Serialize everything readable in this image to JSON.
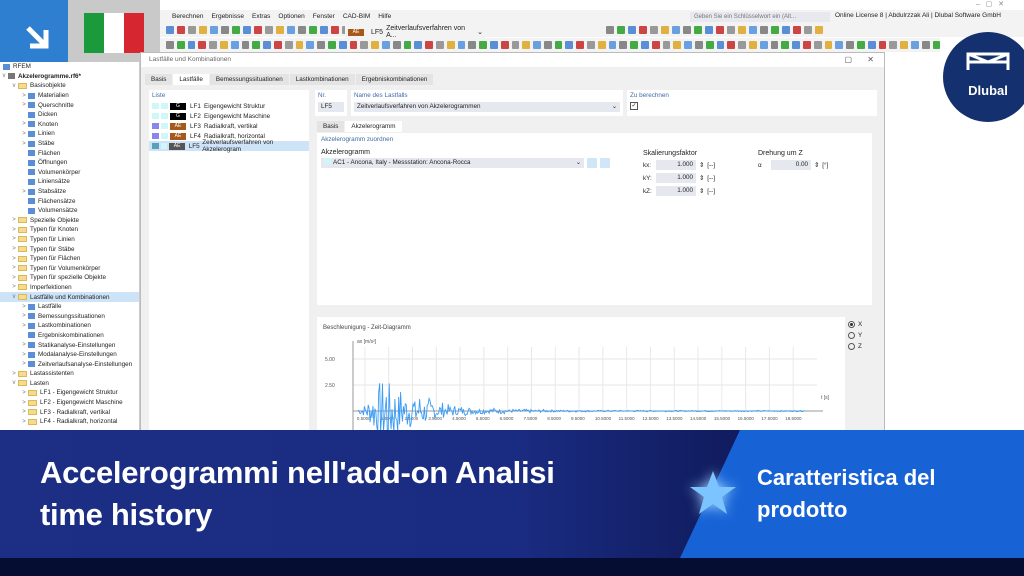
{
  "menu": [
    "Berechnen",
    "Ergebnisse",
    "Extras",
    "Optionen",
    "Fenster",
    "CAD-BIM",
    "Hilfe"
  ],
  "search_placeholder": "Geben Sie ein Schlüsselwort ein (Alt...",
  "license": "Online License 8 | Abdulrzzak Ali | Dlubal Software GmbH",
  "toolbar": {
    "lc_badge": "AE",
    "lc_id": "LF5",
    "lc_name": "Zeitverlaufsverfahren von A..."
  },
  "tree": {
    "root": "RFEM",
    "file": "Akzelerogramme.rf6*",
    "items": [
      {
        "label": "Basisobjekte",
        "lvl": 1,
        "type": "folder",
        "exp": "v"
      },
      {
        "label": "Materialien",
        "lvl": 2,
        "type": "obj",
        "exp": ">"
      },
      {
        "label": "Querschnitte",
        "lvl": 2,
        "type": "obj",
        "exp": ">"
      },
      {
        "label": "Dicken",
        "lvl": 2,
        "type": "obj",
        "exp": ""
      },
      {
        "label": "Knoten",
        "lvl": 2,
        "type": "obj",
        "exp": ">"
      },
      {
        "label": "Linien",
        "lvl": 2,
        "type": "obj",
        "exp": ">"
      },
      {
        "label": "Stäbe",
        "lvl": 2,
        "type": "obj",
        "exp": ">"
      },
      {
        "label": "Flächen",
        "lvl": 2,
        "type": "obj",
        "exp": ""
      },
      {
        "label": "Öffnungen",
        "lvl": 2,
        "type": "obj",
        "exp": ""
      },
      {
        "label": "Volumenkörper",
        "lvl": 2,
        "type": "obj",
        "exp": ""
      },
      {
        "label": "Liniensätze",
        "lvl": 2,
        "type": "obj",
        "exp": ""
      },
      {
        "label": "Stabsätze",
        "lvl": 2,
        "type": "obj",
        "exp": ">"
      },
      {
        "label": "Flächensätze",
        "lvl": 2,
        "type": "obj",
        "exp": ""
      },
      {
        "label": "Volumensätze",
        "lvl": 2,
        "type": "obj",
        "exp": ""
      },
      {
        "label": "Spezielle Objekte",
        "lvl": 1,
        "type": "folder",
        "exp": ">"
      },
      {
        "label": "Typen für Knoten",
        "lvl": 1,
        "type": "folder",
        "exp": ">"
      },
      {
        "label": "Typen für Linien",
        "lvl": 1,
        "type": "folder",
        "exp": ">"
      },
      {
        "label": "Typen für Stäbe",
        "lvl": 1,
        "type": "folder",
        "exp": ">"
      },
      {
        "label": "Typen für Flächen",
        "lvl": 1,
        "type": "folder",
        "exp": ">"
      },
      {
        "label": "Typen für Volumenkörper",
        "lvl": 1,
        "type": "folder",
        "exp": ">"
      },
      {
        "label": "Typen für spezielle Objekte",
        "lvl": 1,
        "type": "folder",
        "exp": ">"
      },
      {
        "label": "Imperfektionen",
        "lvl": 1,
        "type": "folder",
        "exp": ">"
      },
      {
        "label": "Lastfälle und Kombinationen",
        "lvl": 1,
        "type": "folder",
        "exp": "v",
        "sel": true
      },
      {
        "label": "Lastfälle",
        "lvl": 2,
        "type": "obj",
        "exp": ">"
      },
      {
        "label": "Bemessungssituationen",
        "lvl": 2,
        "type": "obj",
        "exp": ">"
      },
      {
        "label": "Lastkombinationen",
        "lvl": 2,
        "type": "obj",
        "exp": ">"
      },
      {
        "label": "Ergebniskombinationen",
        "lvl": 2,
        "type": "obj",
        "exp": ""
      },
      {
        "label": "Statikanalyse-Einstellungen",
        "lvl": 2,
        "type": "obj",
        "exp": ">"
      },
      {
        "label": "Modalanalyse-Einstellungen",
        "lvl": 2,
        "type": "obj",
        "exp": ">"
      },
      {
        "label": "Zeitverlaufsanalyse-Einstellungen",
        "lvl": 2,
        "type": "obj",
        "exp": ">"
      },
      {
        "label": "Lastassistenten",
        "lvl": 1,
        "type": "folder",
        "exp": ">"
      },
      {
        "label": "Lasten",
        "lvl": 1,
        "type": "folder",
        "exp": "v"
      },
      {
        "label": "LF1 - Eigengewicht Struktur",
        "lvl": 2,
        "type": "folder",
        "exp": ">"
      },
      {
        "label": "LF2 - Eigengewicht Maschine",
        "lvl": 2,
        "type": "folder",
        "exp": ">"
      },
      {
        "label": "LF3 - Radialkraft, vertikal",
        "lvl": 2,
        "type": "folder",
        "exp": ">"
      },
      {
        "label": "LF4 - Radialkraft, horizontal",
        "lvl": 2,
        "type": "folder",
        "exp": ">"
      }
    ]
  },
  "dialog": {
    "title": "Lastfälle und Kombinationen",
    "tabs": [
      "Basis",
      "Lastfälle",
      "Bemessungssituationen",
      "Lastkombinationen",
      "Ergebniskombinationen"
    ],
    "list_label": "Liste",
    "list": [
      {
        "id": "LF1",
        "name": "Eigengewicht Struktur",
        "badge": "G",
        "badge_color": "#000000",
        "c1": "#cff7fa"
      },
      {
        "id": "LF2",
        "name": "Eigengewicht Maschine",
        "badge": "G",
        "badge_color": "#000000",
        "c1": "#cff7fa"
      },
      {
        "id": "LF3",
        "name": "Radialkraft, vertikal",
        "badge": "AE",
        "badge_color": "#a55a1c",
        "c1": "#8a86f0"
      },
      {
        "id": "LF4",
        "name": "Radialkraft, horizontal",
        "badge": "AE",
        "badge_color": "#a55a1c",
        "c1": "#8a86f0"
      },
      {
        "id": "LF5",
        "name": "Zeitverlaufsverfahren von Akzelerogram",
        "badge": "AE",
        "badge_color": "#555555",
        "c1": "#5aa0b8"
      }
    ],
    "nr_label": "Nr.",
    "nr_value": "LF5",
    "name_label": "Name des Lastfalls",
    "name_value": "Zeitverlaufsverfahren von Akzelerogrammen",
    "calc_label": "Zu berechnen",
    "subtabs": [
      "Basis",
      "Akzelerogramm"
    ],
    "assign_label": "Akzelerogramm zuordnen",
    "accel_label": "Akzelerogramm",
    "accel_value": "AC1 - Ancona, Italy - Messstation: Ancona-Rocca",
    "scale_label": "Skalierungsfaktor",
    "scale": [
      {
        "k": "kx:",
        "v": "1.000",
        "u": "[--]"
      },
      {
        "k": "kY:",
        "v": "1.000",
        "u": "[--]"
      },
      {
        "k": "kZ:",
        "v": "1.000",
        "u": "[--]"
      }
    ],
    "rot_label": "Drehung um Z",
    "rot_sym": "α",
    "rot_value": "0.00",
    "rot_unit": "[°]",
    "radio": [
      "X",
      "Y",
      "Z"
    ]
  },
  "chart_data": {
    "type": "line",
    "title": "Beschleunigung - Zeit-Diagramm",
    "ylabel": "ax [m/s²]",
    "xlabel": "t [s]",
    "yticks": [
      "5.00",
      "2.50"
    ],
    "xticks": [
      "0.5000",
      "1.5000",
      "2.5000",
      "3.5000",
      "4.5000",
      "5.5000",
      "6.5000",
      "7.5000",
      "8.5000",
      "9.5000",
      "10.5000",
      "11.5000",
      "12.5000",
      "13.5000",
      "14.5000",
      "15.5000",
      "16.5000",
      "17.5000",
      "18.5000"
    ],
    "xlim": [
      0,
      19.5
    ],
    "ylim": [
      -2.5,
      6
    ],
    "envelope_t": [
      0,
      0.5,
      1,
      1.3,
      1.5,
      1.8,
      2.2,
      2.8,
      3.5,
      4.5,
      5.5,
      6.5,
      8,
      10,
      19
    ],
    "envelope_a": [
      0.3,
      0.6,
      2.5,
      5.2,
      4.0,
      3.0,
      2.0,
      1.7,
      1.0,
      0.5,
      0.35,
      0.25,
      0.15,
      0.08,
      0.06
    ]
  },
  "banner": {
    "title_line1": "Accelerogrammi nell'add-on Analisi",
    "title_line2": "time history",
    "tag_line1": "Caratteristica del",
    "tag_line2": "prodotto"
  },
  "brand": "Dlubal",
  "colors": {
    "banner": "#1c2f85",
    "tag": "#1763d6",
    "series": "#3b9cf5"
  }
}
